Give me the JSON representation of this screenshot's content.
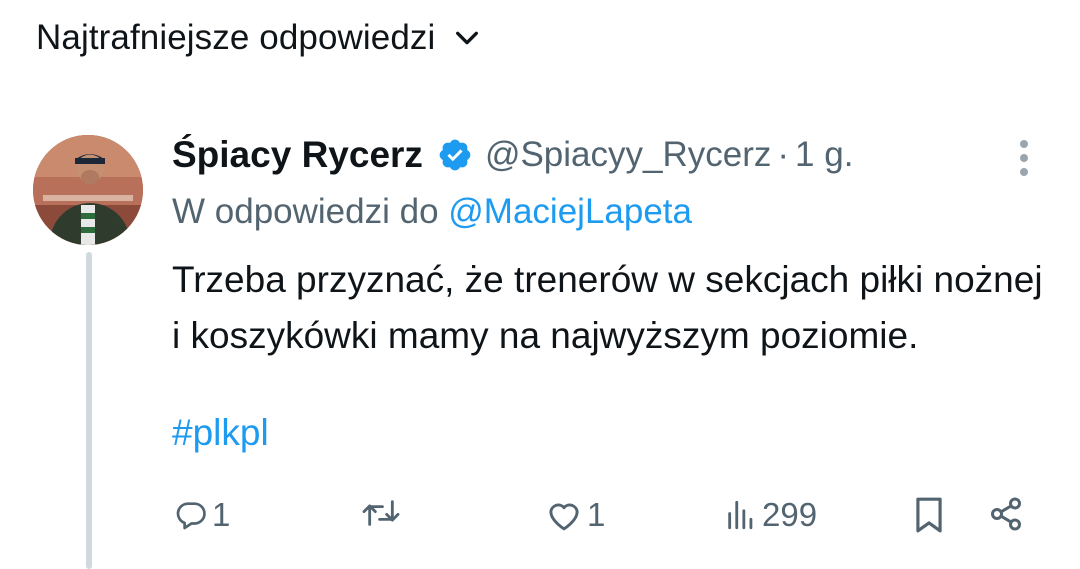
{
  "sort": {
    "label": "Najtrafniejsze odpowiedzi",
    "chevron_icon": "chevron-down-icon"
  },
  "tweet": {
    "display_name": "Śpiacy Rycerz",
    "verified_icon": "verified-badge-icon",
    "handle": "@Spiacyy_Rycerz",
    "separator": "·",
    "time": "1 g.",
    "reply_prefix": "W odpowiedzi do",
    "reply_to": "@MaciejLapeta",
    "text": "Trzeba przyznać, że trenerów w sekcjach piłki nożnej i koszykówki mamy na najwyższym poziomie.",
    "hashtag": "#plkpl"
  },
  "actions": {
    "replies": "1",
    "retweets": "",
    "likes": "1",
    "views": "299"
  },
  "colors": {
    "accent": "#1d9bf0",
    "secondary_text": "#536471",
    "thread_line": "#cfd9de"
  }
}
